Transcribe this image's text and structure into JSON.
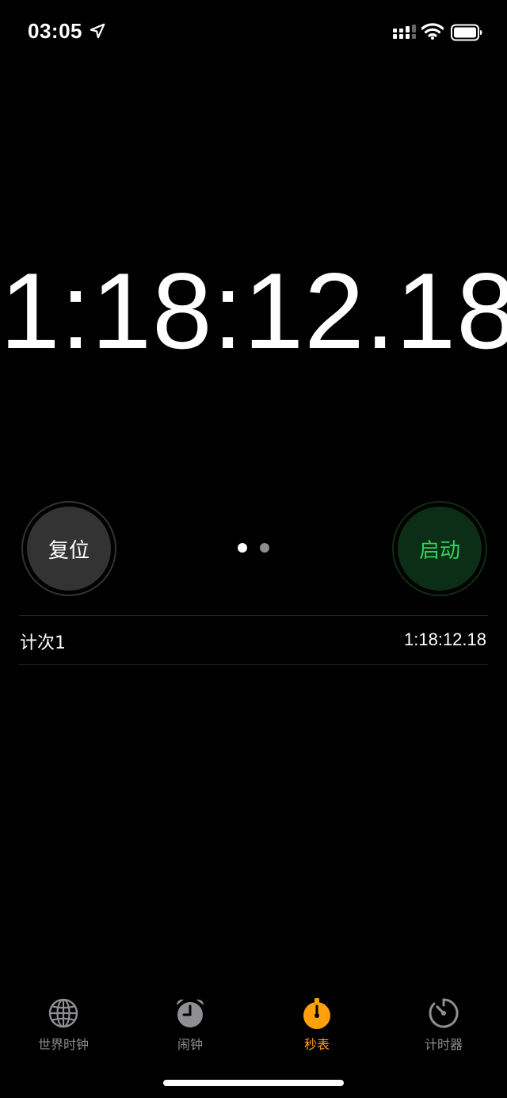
{
  "status": {
    "time": "03:05",
    "icons": [
      "location-arrow-icon",
      "cellular-signal-icon",
      "wifi-icon",
      "battery-icon"
    ]
  },
  "stopwatch": {
    "time": "1:18:12.18"
  },
  "buttons": {
    "reset_label": "复位",
    "start_label": "启动"
  },
  "laps": [
    {
      "label": "计次1",
      "time": "1:18:12.18"
    }
  ],
  "tabs": [
    {
      "label": "世界时钟",
      "icon": "globe-icon",
      "active": false
    },
    {
      "label": "闹钟",
      "icon": "alarm-clock-icon",
      "active": false
    },
    {
      "label": "秒表",
      "icon": "stopwatch-icon",
      "active": true
    },
    {
      "label": "计时器",
      "icon": "timer-icon",
      "active": false
    }
  ],
  "colors": {
    "accent": "#ff9f0a",
    "start_green": "#33d15e",
    "start_bg": "#0d2e16",
    "reset_bg": "#333333",
    "inactive_tab": "#8e8e93"
  }
}
